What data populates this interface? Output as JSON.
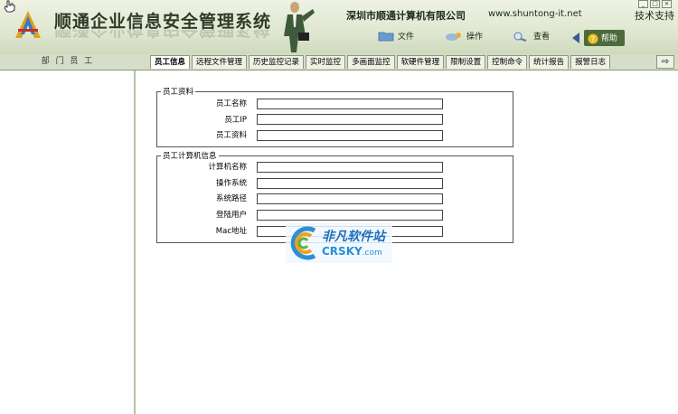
{
  "header": {
    "app_title": "顺通企业信息安全管理系统",
    "company": "深圳市顺通计算机有限公司",
    "website": "www.shuntong-it.net",
    "support": "技术支持"
  },
  "menu": {
    "file": "文件",
    "operate": "操作",
    "view": "查看",
    "help": "帮助"
  },
  "sidebar": {
    "title": "部 门 员 工"
  },
  "tabs": [
    {
      "label": "员工信息",
      "active": true
    },
    {
      "label": "远程文件管理"
    },
    {
      "label": "历史监控记录"
    },
    {
      "label": "实时监控"
    },
    {
      "label": "多画面监控"
    },
    {
      "label": "软硬件管理"
    },
    {
      "label": "限制设置"
    },
    {
      "label": "控制命令"
    },
    {
      "label": "统计报告"
    },
    {
      "label": "报警日志"
    }
  ],
  "employee_group": {
    "legend": "员工资料",
    "fields": [
      {
        "label": "员工名称",
        "value": ""
      },
      {
        "label": "员工IP",
        "value": ""
      },
      {
        "label": "员工资料",
        "value": ""
      }
    ]
  },
  "computer_group": {
    "legend": "员工计算机信息",
    "fields": [
      {
        "label": "计算机名称",
        "value": ""
      },
      {
        "label": "操作系统",
        "value": ""
      },
      {
        "label": "系统路径",
        "value": ""
      },
      {
        "label": "登陆用户",
        "value": ""
      },
      {
        "label": "Mac地址",
        "value": ""
      }
    ]
  },
  "watermark": {
    "cn": "非凡软件站",
    "en": "CRSKY",
    "en_suffix": ".com"
  }
}
